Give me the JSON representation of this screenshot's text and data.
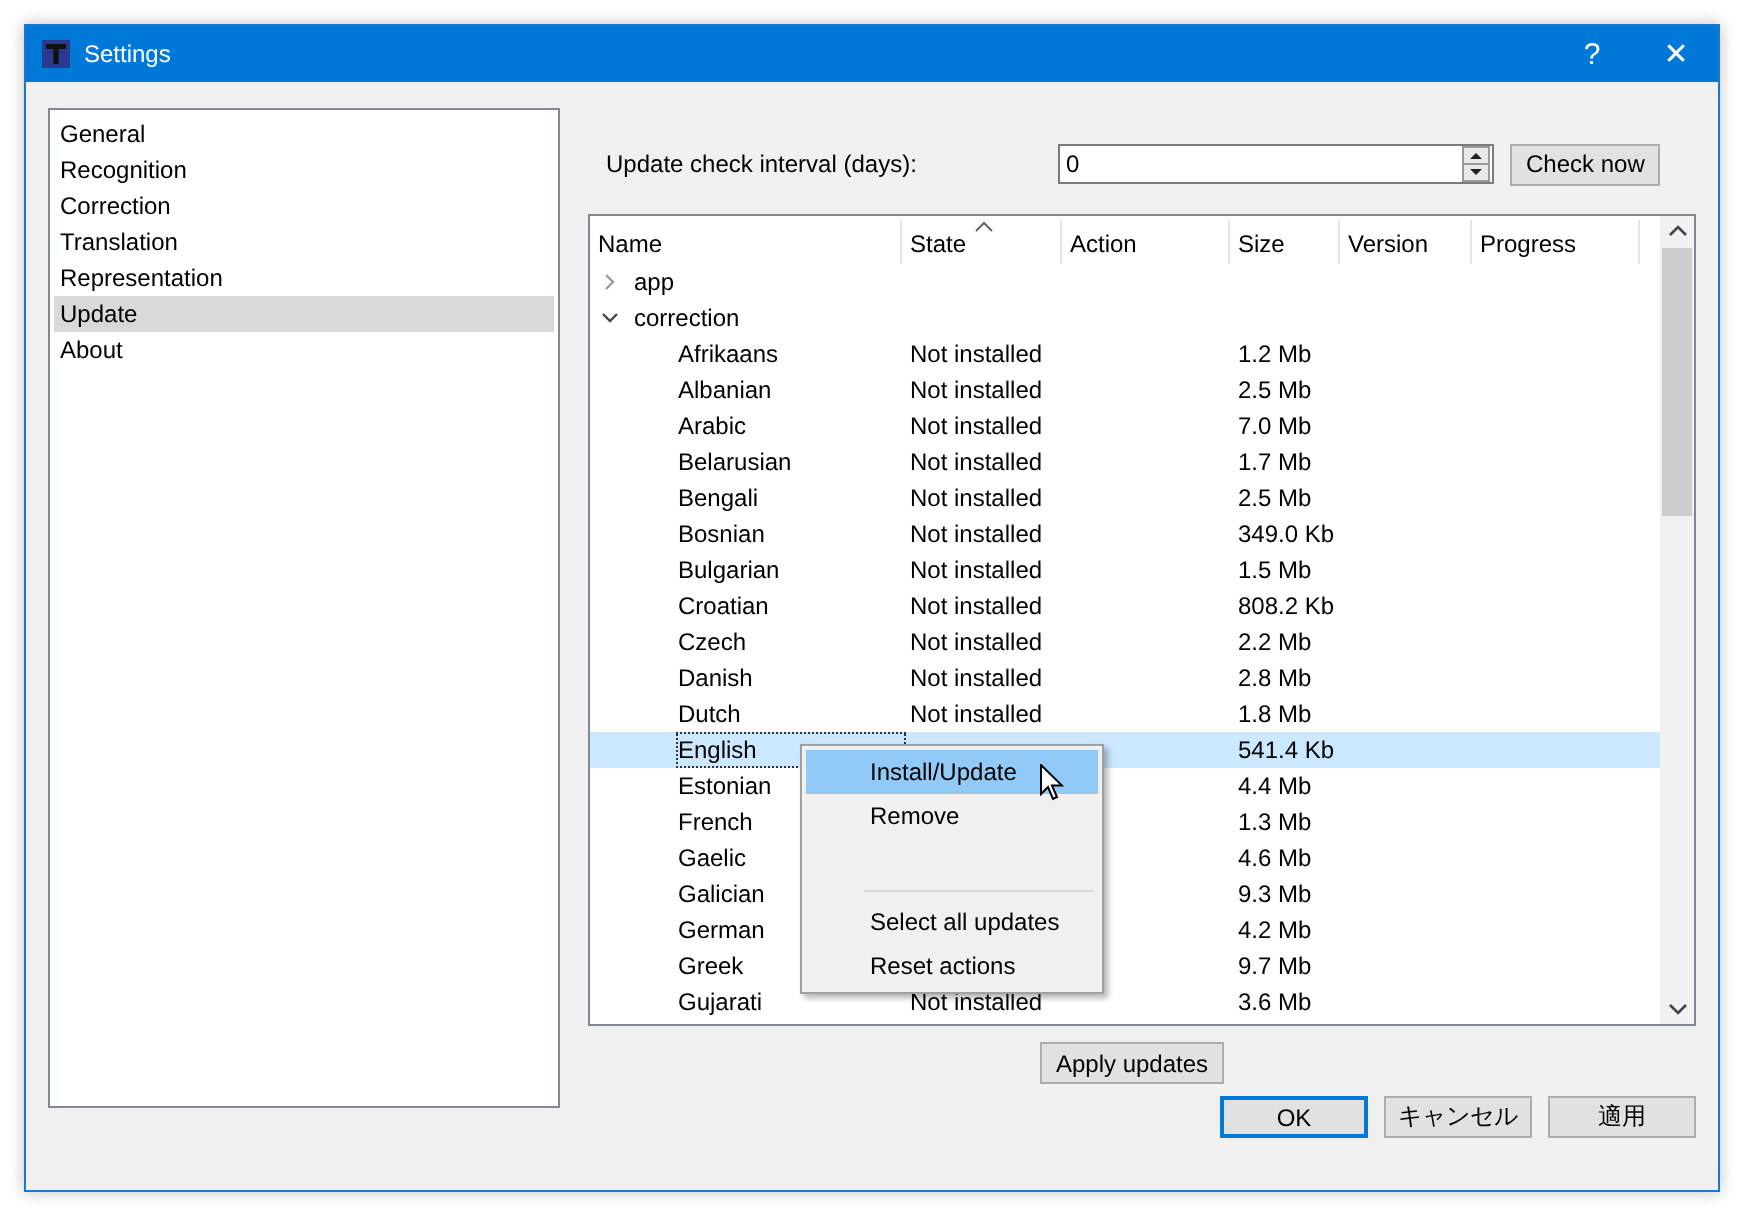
{
  "window": {
    "title": "Settings",
    "help_button": "?",
    "close_button": "✕"
  },
  "sidebar": {
    "items": [
      {
        "label": "General",
        "selected": false
      },
      {
        "label": "Recognition",
        "selected": false
      },
      {
        "label": "Correction",
        "selected": false
      },
      {
        "label": "Translation",
        "selected": false
      },
      {
        "label": "Representation",
        "selected": false
      },
      {
        "label": "Update",
        "selected": true
      },
      {
        "label": "About",
        "selected": false
      }
    ]
  },
  "update": {
    "interval_label": "Update check interval (days):",
    "interval_value": "0",
    "check_now_button": "Check now",
    "tree": {
      "columns": [
        {
          "label": "Name",
          "sorted": false
        },
        {
          "label": "State",
          "sorted": true
        },
        {
          "label": "Action",
          "sorted": false
        },
        {
          "label": "Size",
          "sorted": false
        },
        {
          "label": "Version",
          "sorted": false
        },
        {
          "label": "Progress",
          "sorted": false
        }
      ],
      "nodes": [
        {
          "name": "app",
          "expanded": false
        },
        {
          "name": "correction",
          "expanded": true,
          "children": [
            {
              "name": "Afrikaans",
              "state": "Not installed",
              "size": "1.2 Mb",
              "selected": false
            },
            {
              "name": "Albanian",
              "state": "Not installed",
              "size": "2.5 Mb",
              "selected": false
            },
            {
              "name": "Arabic",
              "state": "Not installed",
              "size": "7.0 Mb",
              "selected": false
            },
            {
              "name": "Belarusian",
              "state": "Not installed",
              "size": "1.7 Mb",
              "selected": false
            },
            {
              "name": "Bengali",
              "state": "Not installed",
              "size": "2.5 Mb",
              "selected": false
            },
            {
              "name": "Bosnian",
              "state": "Not installed",
              "size": "349.0 Kb",
              "selected": false
            },
            {
              "name": "Bulgarian",
              "state": "Not installed",
              "size": "1.5 Mb",
              "selected": false
            },
            {
              "name": "Croatian",
              "state": "Not installed",
              "size": "808.2 Kb",
              "selected": false
            },
            {
              "name": "Czech",
              "state": "Not installed",
              "size": "2.2 Mb",
              "selected": false
            },
            {
              "name": "Danish",
              "state": "Not installed",
              "size": "2.8 Mb",
              "selected": false
            },
            {
              "name": "Dutch",
              "state": "Not installed",
              "size": "1.8 Mb",
              "selected": false
            },
            {
              "name": "English",
              "size": "541.4 Kb",
              "selected": true
            },
            {
              "name": "Estonian",
              "size": "4.4 Mb",
              "selected": false
            },
            {
              "name": "French",
              "size": "1.3 Mb",
              "selected": false
            },
            {
              "name": "Gaelic",
              "size": "4.6 Mb",
              "selected": false
            },
            {
              "name": "Galician",
              "size": "9.3 Mb",
              "selected": false
            },
            {
              "name": "German",
              "size": "4.2 Mb",
              "selected": false
            },
            {
              "name": "Greek",
              "size": "9.7 Mb",
              "selected": false
            },
            {
              "name": "Gujarati",
              "state": "Not installed",
              "size": "3.6 Mb",
              "selected": false
            }
          ]
        }
      ]
    },
    "apply_updates_button": "Apply updates"
  },
  "context_menu": {
    "items": [
      {
        "kind": "item",
        "label": "Install/Update",
        "selected": true
      },
      {
        "kind": "item",
        "label": "Remove",
        "selected": false
      },
      {
        "kind": "separator"
      },
      {
        "kind": "item",
        "label": "Select all updates",
        "selected": false
      },
      {
        "kind": "item",
        "label": "Reset actions",
        "selected": false
      }
    ]
  },
  "buttons": [
    {
      "label": "OK",
      "default": true
    },
    {
      "label": "キャンセル",
      "default": false
    },
    {
      "label": "適用",
      "default": false
    }
  ]
}
